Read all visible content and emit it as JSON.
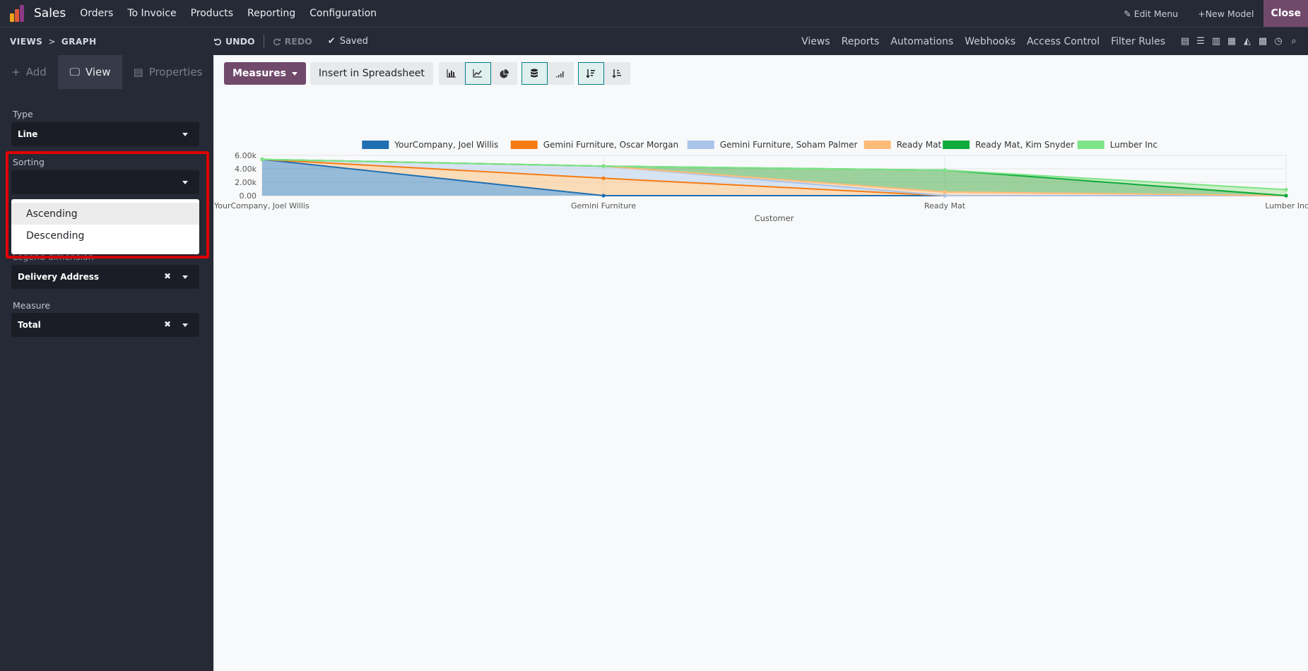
{
  "navbar": {
    "app_name": "Sales",
    "menu": [
      "Orders",
      "To Invoice",
      "Products",
      "Reporting",
      "Configuration"
    ],
    "edit_menu": "Edit Menu",
    "new_model": "New Model",
    "close": "Close"
  },
  "subbar": {
    "breadcrumb_root": "VIEWS",
    "breadcrumb_sep": ">",
    "breadcrumb_current": "GRAPH",
    "undo": "UNDO",
    "redo": "REDO",
    "saved": "Saved",
    "links": [
      "Views",
      "Reports",
      "Automations",
      "Webhooks",
      "Access Control",
      "Filter Rules"
    ]
  },
  "sidebar": {
    "tabs": {
      "add": "Add",
      "view": "View",
      "properties": "Properties"
    },
    "type_label": "Type",
    "type_value": "Line",
    "sorting_label": "Sorting",
    "sorting_value": "",
    "sorting_options": [
      "Ascending",
      "Descending"
    ],
    "legend_label": "Legend dimension",
    "legend_value": "Delivery Address",
    "measure_label": "Measure",
    "measure_value": "Total"
  },
  "toolbar": {
    "measures": "Measures",
    "insert": "Insert in Spreadsheet"
  },
  "colors": {
    "accent": "#71496b",
    "highlight": "#e00000",
    "active_outline": "#017e84"
  },
  "chart_data": {
    "type": "area",
    "xlabel": "Customer",
    "categories": [
      "YourCompany, Joel Willis",
      "Gemini Furniture",
      "Ready Mat",
      "Lumber Inc"
    ],
    "y_ticks": [
      "0.00",
      "2.00k",
      "4.00k",
      "6.00k"
    ],
    "ylim": [
      0,
      6000
    ],
    "stacked": true,
    "legend_position": "top",
    "series": [
      {
        "name": "YourCompany, Joel Willis",
        "color": "#1f6fb2",
        "fill": "#1f6fb2",
        "values": [
          5400,
          0,
          0,
          0
        ]
      },
      {
        "name": "Gemini Furniture, Oscar Morgan",
        "color": "#f57c14",
        "fill": "#ffb86b",
        "values": [
          0,
          2600,
          0,
          0
        ]
      },
      {
        "name": "Gemini Furniture, Soham Palmer",
        "color": "#a9c4e8",
        "fill": "#aec7e8",
        "values": [
          0,
          1800,
          0,
          0
        ]
      },
      {
        "name": "Ready Mat",
        "color": "#ffbb78",
        "fill": "#ffbb78",
        "values": [
          0,
          0,
          550,
          0
        ]
      },
      {
        "name": "Ready Mat, Kim Snyder",
        "color": "#0fac3c",
        "fill": "#2ca02c",
        "values": [
          0,
          0,
          3250,
          0
        ]
      },
      {
        "name": "Lumber Inc",
        "color": "#7ee487",
        "fill": "#98df8a",
        "values": [
          0,
          0,
          0,
          900
        ]
      }
    ]
  }
}
